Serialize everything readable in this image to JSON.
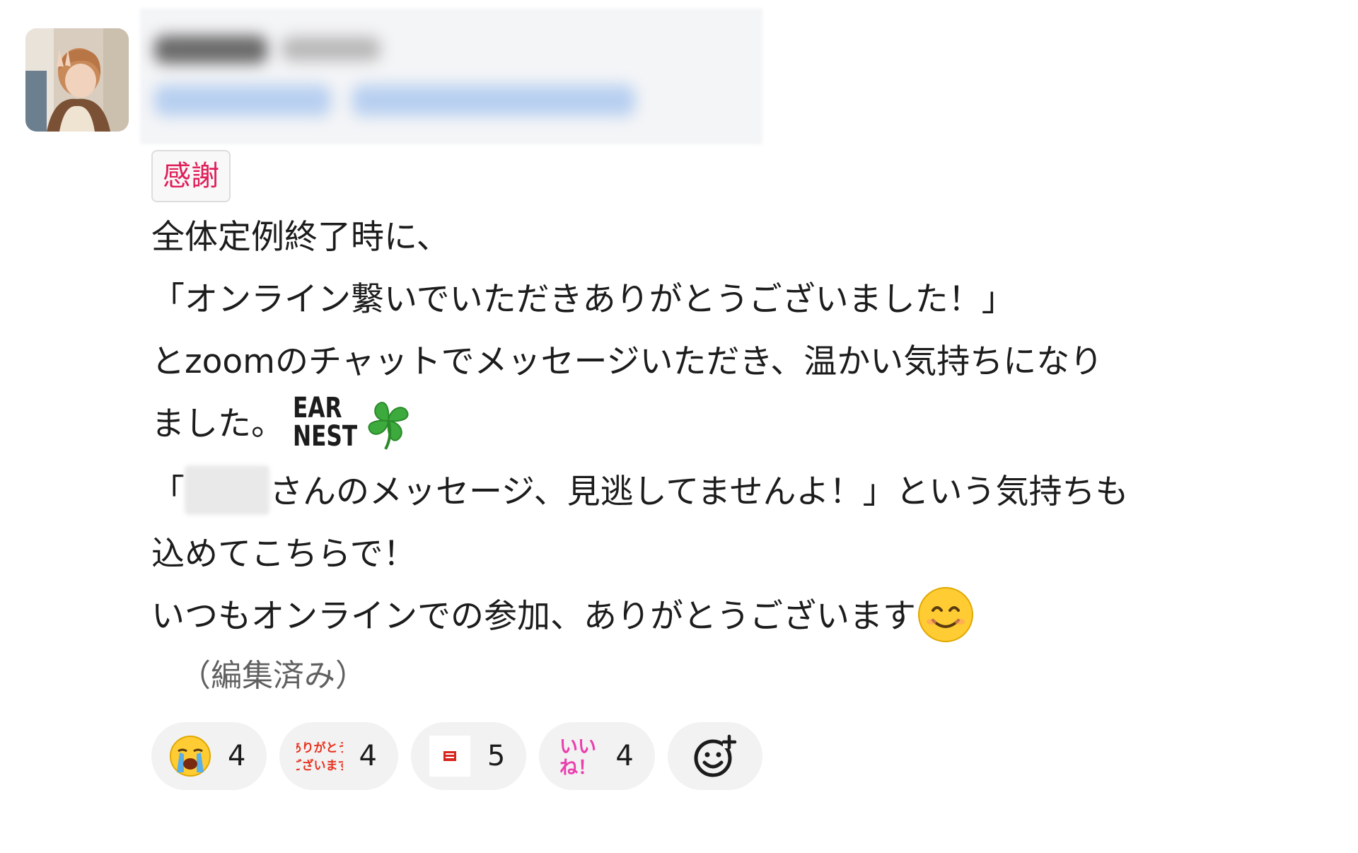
{
  "tag": {
    "label": "感謝",
    "color": "#e01e5a"
  },
  "message": {
    "lines": [
      "全体定例終了時に、",
      "「オンライン繋いでいただきありがとうございました！」",
      "とzoomのチャットでメッセージいただき、温かい気持ちになり",
      "ました。"
    ],
    "earnest_top": "EAR",
    "earnest_bottom": "NEST",
    "para2_open": "「",
    "para2_rest": "さんのメッセージ、見逃してませんよ！」という気持ちも",
    "para2_line2": "込めてこちらで！",
    "para2_line3": "いつもオンラインでの参加、ありがとうございます",
    "edited": "（編集済み）"
  },
  "reactions": [
    {
      "icon": "loudly-crying-face-icon",
      "count": "4"
    },
    {
      "icon": "arigatou-gozaimasu-stamp-icon",
      "stamp_line1": "ありがとう",
      "stamp_line2": "ございます",
      "count": "4"
    },
    {
      "icon": "custom-red-stamp-icon",
      "count": "5"
    },
    {
      "icon": "iine-stamp-icon",
      "stamp_line1": "いい",
      "stamp_line2": "ね！",
      "count": "4"
    }
  ],
  "add_reaction": {
    "icon": "add-reaction-icon"
  },
  "colors": {
    "tag_text": "#e01e5a",
    "reaction_bg": "#f2f2f2",
    "text": "#1d1c1d",
    "muted": "#616061"
  }
}
